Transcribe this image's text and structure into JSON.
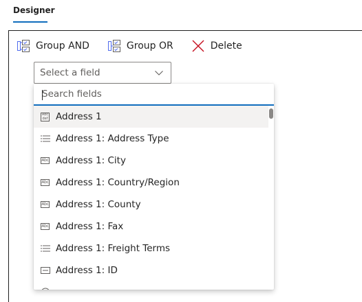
{
  "tabs": [
    {
      "label": "Designer",
      "active": true
    }
  ],
  "toolbar": {
    "group_and_label": "Group AND",
    "group_or_label": "Group OR",
    "delete_label": "Delete"
  },
  "field_select": {
    "placeholder": "Select a field"
  },
  "dropdown": {
    "search_placeholder": "Search fields",
    "search_value": "",
    "items": [
      {
        "label": "Address 1",
        "icon": "multiline-text-icon",
        "selected": true
      },
      {
        "label": "Address 1: Address Type",
        "icon": "option-set-icon",
        "selected": false
      },
      {
        "label": "Address 1: City",
        "icon": "text-icon",
        "selected": false
      },
      {
        "label": "Address 1: Country/Region",
        "icon": "text-icon",
        "selected": false
      },
      {
        "label": "Address 1: County",
        "icon": "text-icon",
        "selected": false
      },
      {
        "label": "Address 1: Fax",
        "icon": "text-icon",
        "selected": false
      },
      {
        "label": "Address 1: Freight Terms",
        "icon": "option-set-icon",
        "selected": false
      },
      {
        "label": "Address 1: ID",
        "icon": "id-card-icon",
        "selected": false
      }
    ]
  },
  "colors": {
    "accent": "#0f6cbd",
    "delete_icon": "#c50f1f",
    "group_icon": "#4f6bed",
    "selected_row": "#f3f2f1"
  }
}
